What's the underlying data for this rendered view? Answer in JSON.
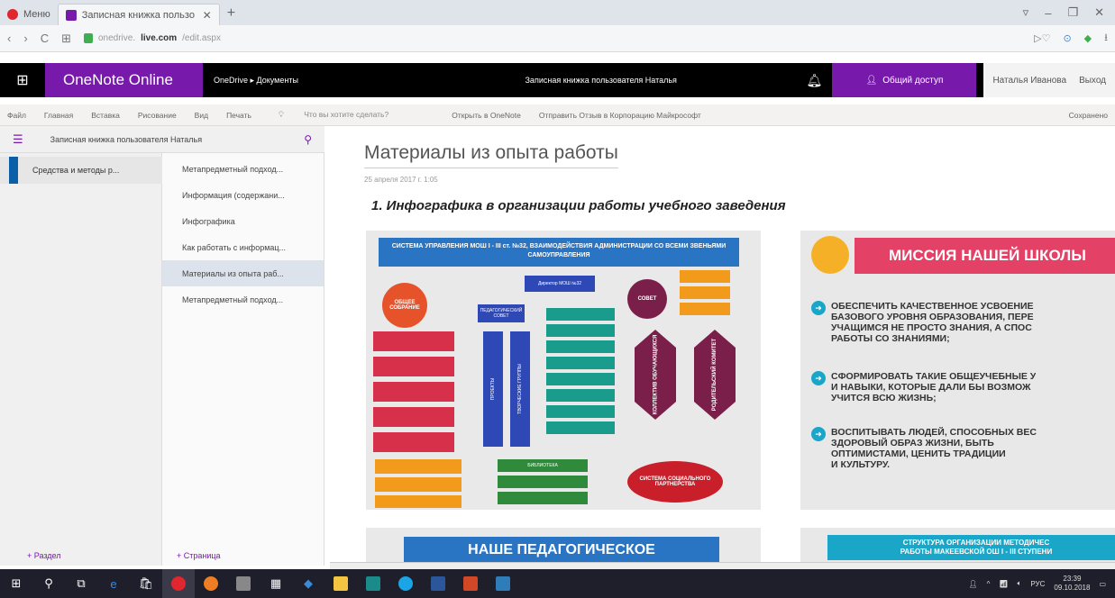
{
  "browser": {
    "tabs": [
      {
        "label": "Меню"
      },
      {
        "label": "Записная книжка пользо"
      }
    ],
    "new_tab": "+",
    "address": {
      "prefix": "onedrive.",
      "domain": "live.com",
      "path": "/edit.aspx"
    }
  },
  "app": {
    "name": "OneNote Online",
    "breadcrumb": "OneDrive ▸ Документы",
    "notebook_title": "Записная книжка пользователя Наталья",
    "share_label": "Общий доступ",
    "user_name": "Наталья Иванова",
    "sign_out": "Выход"
  },
  "ribbon": {
    "tabs": [
      "Файл",
      "Главная",
      "Вставка",
      "Рисование",
      "Вид",
      "Печать"
    ],
    "tell_me": "Что вы хотите сделать?",
    "open_in": "Открыть в OneNote",
    "feedback": "Отправить Отзыв в Корпорацию Майкрософт",
    "status": "Сохранено"
  },
  "navigator": {
    "notebook_name": "Записная книжка пользователя Наталья",
    "sections": [
      {
        "label": "Средства и методы р..."
      }
    ],
    "pages": [
      {
        "label": "Метапредметный подход..."
      },
      {
        "label": "Информация (содержани..."
      },
      {
        "label": "Инфографика"
      },
      {
        "label": "Как работать с информац..."
      },
      {
        "label": "Материалы из опыта раб..."
      },
      {
        "label": "Метапредметный подход..."
      }
    ],
    "selected_page_index": 4,
    "add_section": "+ Раздел",
    "add_page": "+ Страница"
  },
  "page": {
    "title": "Материалы из опыта работы",
    "date": "25 апреля 2017 г.   1:05",
    "heading": "1.  Инфографика в организации работы учебного заведения",
    "infographic_management": {
      "banner": "СИСТЕМА УПРАВЛЕНИЯ МОШ I - III ст. №32, ВЗАИМОДЕЙСТВИЯ АДМИНИСТРАЦИИ СО ВСЕМИ ЗВЕНЬЯМИ САМОУПРАВЛЕНИЯ",
      "general_meeting": "ОБЩЕЕ СОБРАНИЕ",
      "director": "Директор МОШ №32",
      "ped_council": "ПЕДАГОГИЧЕСКИЙ СОВЕТ",
      "council": "СОВЕТ",
      "projects": "ПРОЕКТЫ",
      "creative_groups": "ТВОРЧЕСКИЕ ГРУППЫ",
      "students": "КОЛЛЕКТИВ ОБУЧАЮЩИХСЯ",
      "parents": "РОДИТЕЛЬСКИЙ КОМИТЕТ",
      "library": "БИБЛИОТЕКА",
      "partnership": "СИСТЕМА СОЦИАЛЬНОГО ПАРТНЕРСТВА"
    },
    "mission": {
      "title": "МИССИЯ НАШЕЙ ШКОЛЫ",
      "bullets": [
        "ОБЕСПЕЧИТЬ КАЧЕСТВЕННОЕ УСВОЕНИЕ\nБАЗОВОГО УРОВНЯ ОБРАЗОВАНИЯ, ПЕРЕ\nУЧАЩИМСЯ НЕ ПРОСТО ЗНАНИЯ, А СПОС\nРАБОТЫ СО ЗНАНИЯМИ;",
        "СФОРМИРОВАТЬ ТАКИЕ ОБЩЕУЧЕБНЫЕ У\nИ НАВЫКИ, КОТОРЫЕ ДАЛИ БЫ ВОЗМОЖ\nУЧИТСЯ ВСЮ ЖИЗНЬ;",
        "ВОСПИТЫВАТЬ ЛЮДЕЙ, СПОСОБНЫХ ВЕС\nЗДОРОВЫЙ ОБРАЗ ЖИЗНИ, БЫТЬ\nОПТИМИСТАМИ, ЦЕНИТЬ ТРАДИЦИИ\nИ КУЛЬТУРУ."
      ]
    },
    "teachers_banner": "НАШЕ ПЕДАГОГИЧЕСКОЕ",
    "structure_banner": "СТРУКТУРА ОРГАНИЗАЦИИ МЕТОДИЧЕС\nРАБОТЫ МАКЕЕВСКОЙ ОШ I - III СТУПЕНИ"
  },
  "taskbar": {
    "language": "РУС",
    "time": "23:39",
    "date": "09.10.2018"
  },
  "colors": {
    "onenote_purple": "#7719aa",
    "mission_pink": "#e34166",
    "banner_blue": "#2a74c4",
    "bullet_cyan": "#1aa6c9"
  }
}
